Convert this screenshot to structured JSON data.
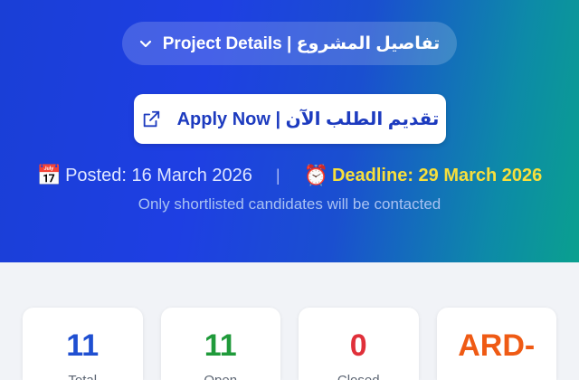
{
  "hero": {
    "project_details_label": "Project Details | تفاصيل المشروع",
    "apply_label": "Apply Now | تقديم الطلب الآن",
    "posted_text": "Posted: 16 March 2026",
    "separator": "|",
    "deadline_text": "Deadline: 29 March 2026",
    "note": "Only shortlisted candidates will be contacted",
    "calendar_emoji": "📅",
    "alarm_emoji": "⏰"
  },
  "stats": [
    {
      "value": "11",
      "label": "Total",
      "color": "#1f4fd1"
    },
    {
      "value": "11",
      "label": "Open",
      "color": "#1f9a3a"
    },
    {
      "value": "0",
      "label": "Closed",
      "color": "#e0303a"
    },
    {
      "value": "ARD-",
      "label": "",
      "color": "#ef5a14"
    }
  ],
  "colors": {
    "hero_gradient_start": "#1a3fd6",
    "hero_gradient_end": "#0aa08f",
    "deadline": "#f7df3c",
    "apply_text": "#1d3bbf"
  }
}
